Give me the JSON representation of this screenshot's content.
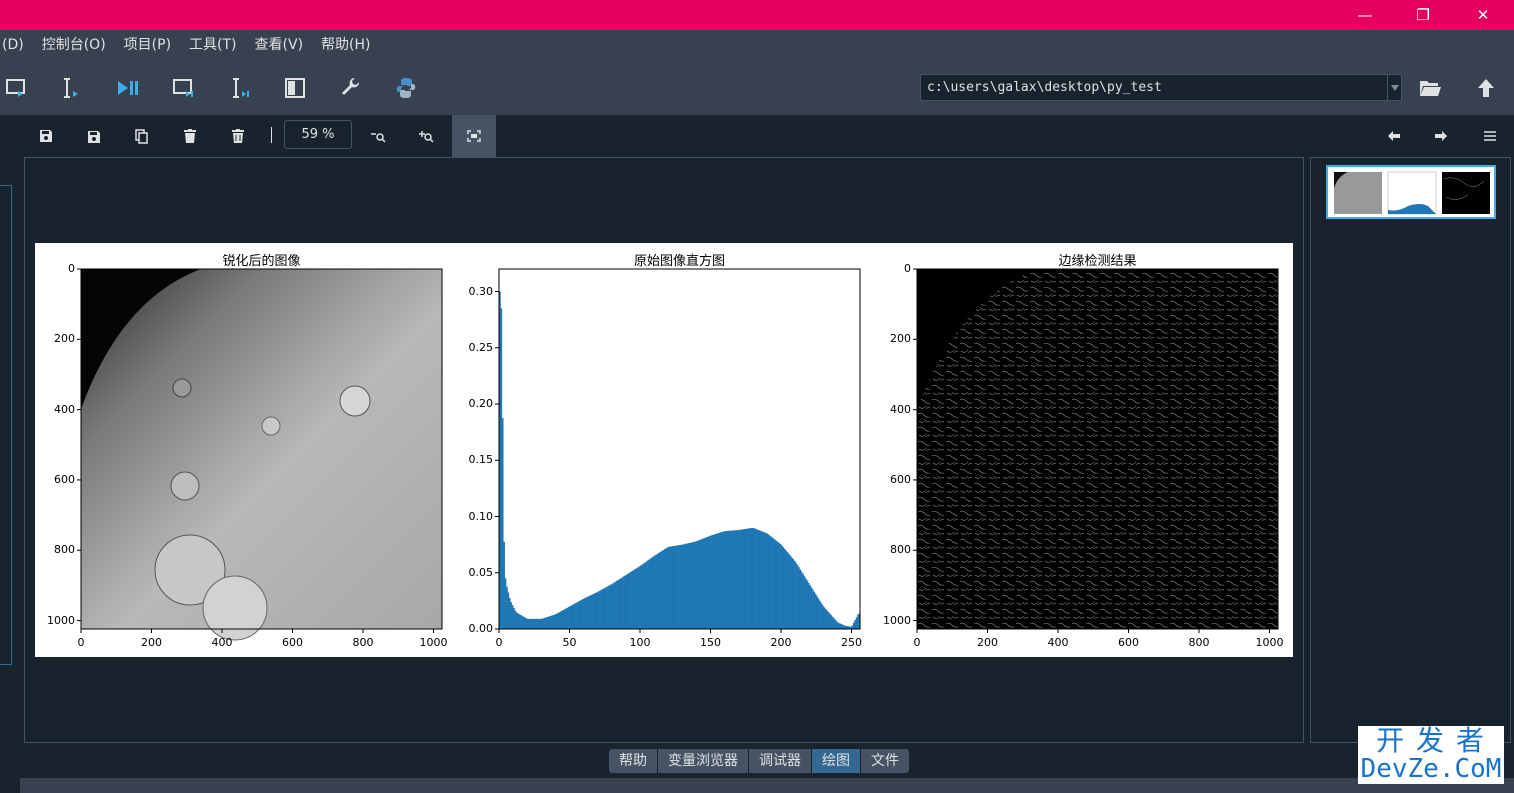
{
  "window": {
    "minimize_glyph": "—",
    "restore_glyph": "❐",
    "close_glyph": "✕"
  },
  "menu": [
    "(D)",
    "控制台(O)",
    "项目(P)",
    "工具(T)",
    "查看(V)",
    "帮助(H)"
  ],
  "toolbar": {
    "icons": [
      "run-file-icon",
      "run-cell-icon",
      "run-cell-advance-icon",
      "run-selection-icon",
      "debug-icon",
      "maximize-pane-icon",
      "preferences-icon",
      "python-path-icon"
    ],
    "working_dir": "c:\\users\\galax\\desktop\\py_test",
    "browse_icon": "folder-open-icon",
    "parent_icon": "arrow-up-icon"
  },
  "plots_toolbar": {
    "zoom": "59 %",
    "icons": [
      "save-icon",
      "save-all-icon",
      "copy-icon",
      "delete-icon",
      "delete-all-icon",
      "zoom-out-icon",
      "zoom-in-icon",
      "fit-icon"
    ]
  },
  "figure": {
    "axes": [
      {
        "title": "锐化后的图像",
        "kind": "image"
      },
      {
        "title": "原始图像直方图",
        "kind": "histogram"
      },
      {
        "title": "边缘检测结果",
        "kind": "image-edges"
      }
    ],
    "image_yticks": [
      "0",
      "200",
      "400",
      "600",
      "800",
      "1000"
    ],
    "image_xticks": [
      "0",
      "200",
      "400",
      "600",
      "800",
      "1000"
    ],
    "hist_yticks": [
      "0.00",
      "0.05",
      "0.10",
      "0.15",
      "0.20",
      "0.25",
      "0.30"
    ],
    "hist_xticks": [
      "0",
      "50",
      "100",
      "150",
      "200",
      "250"
    ],
    "hist_color": "#1f77b4"
  },
  "chart_data": {
    "type": "bar",
    "title": "原始图像直方图",
    "xlabel": "",
    "ylabel": "",
    "xlim": [
      0,
      256
    ],
    "ylim": [
      0,
      0.32
    ],
    "x": [
      1,
      2,
      3,
      4,
      5,
      8,
      12,
      20,
      30,
      40,
      50,
      60,
      70,
      80,
      90,
      100,
      110,
      120,
      130,
      140,
      150,
      160,
      170,
      180,
      190,
      200,
      210,
      220,
      230,
      240,
      245,
      250,
      255
    ],
    "values": [
      0.3,
      0.27,
      0.105,
      0.05,
      0.04,
      0.025,
      0.015,
      0.009,
      0.009,
      0.013,
      0.02,
      0.027,
      0.033,
      0.04,
      0.048,
      0.056,
      0.065,
      0.073,
      0.075,
      0.078,
      0.083,
      0.087,
      0.088,
      0.09,
      0.085,
      0.075,
      0.06,
      0.04,
      0.02,
      0.006,
      0.003,
      0.002,
      0.014
    ]
  },
  "tabs": [
    {
      "label": "帮助",
      "active": false
    },
    {
      "label": "变量浏览器",
      "active": false
    },
    {
      "label": "调试器",
      "active": false
    },
    {
      "label": "绘图",
      "active": true
    },
    {
      "label": "文件",
      "active": false
    }
  ],
  "watermark": {
    "top": "开发者",
    "bottom": "DevZe.CoM"
  }
}
